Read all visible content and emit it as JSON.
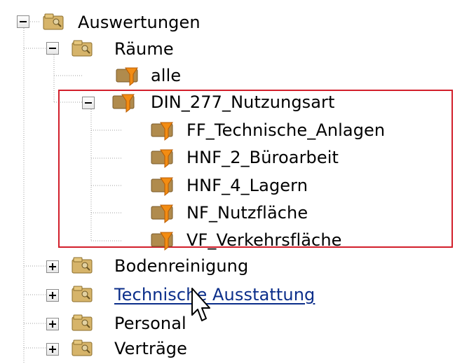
{
  "tree": {
    "root": {
      "label": "Auswertungen",
      "children": [
        {
          "label": "Räume",
          "children": [
            {
              "label": "alle"
            },
            {
              "label": "DIN_277_Nutzungsart",
              "children": [
                {
                  "label": "FF_Technische_Anlagen"
                },
                {
                  "label": "HNF_2_Büroarbeit"
                },
                {
                  "label": "HNF_4_Lagern"
                },
                {
                  "label": "NF_Nutzfläche"
                },
                {
                  "label": "VF_Verkehrsfläche"
                }
              ]
            }
          ]
        },
        {
          "label": "Bodenreinigung"
        },
        {
          "label": "Technische Ausstattung"
        },
        {
          "label": "Personal"
        },
        {
          "label": "Verträge"
        }
      ]
    }
  },
  "icons": {
    "folder": "folder-icon",
    "filter_folder": "filter-folder-icon",
    "expand": "plus-icon",
    "collapse": "minus-icon",
    "cursor": "mouse-cursor-icon"
  },
  "colors": {
    "selection_border": "#d21f2b",
    "link_text": "#0b2e8a",
    "tree_lines": "#9f9f9f",
    "folder_fill": "#d6b46a",
    "filter_funnel": "#f28c13"
  }
}
